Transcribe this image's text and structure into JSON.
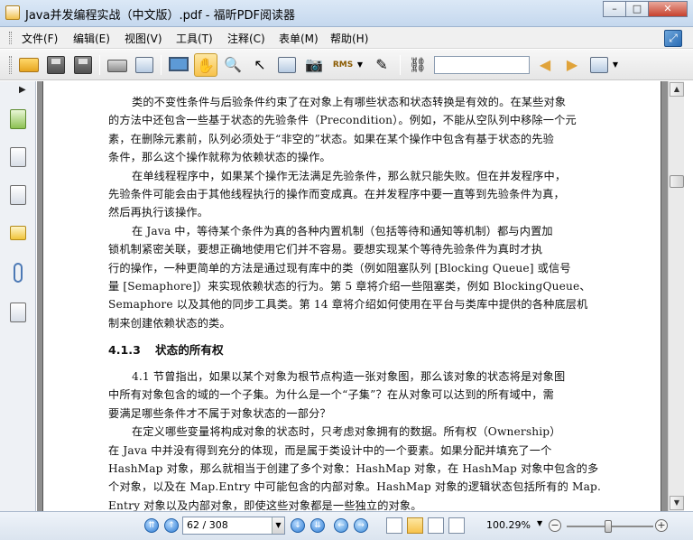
{
  "window": {
    "title": "Java并发编程实战（中文版）.pdf - 福昕PDF阅读器",
    "minimize": "–",
    "maximize": "□",
    "close": "✕"
  },
  "menu": [
    "文件(F)",
    "编辑(E)",
    "视图(V)",
    "工具(T)",
    "注释(C)",
    "表单(M)",
    "帮助(H)"
  ],
  "toolbar": {
    "icons": [
      "open-folder-icon",
      "save-icon",
      "save-as-icon",
      "print-icon",
      "email-icon",
      "fullscreen-icon",
      "hand-tool-icon",
      "zoom-tool-icon",
      "select-arrow-icon",
      "text-select-icon",
      "snapshot-icon",
      "rms-icon",
      "sign-icon",
      "find-binoculars-icon",
      "prev-result-icon",
      "next-result-icon",
      "highlight-icon"
    ],
    "rms_label": "RMS",
    "search_value": ""
  },
  "document": {
    "paragraph1": [
      "类的不变性条件与后验条件约束了在对象上有哪些状态和状态转换是有效的。在某些对象",
      "的方法中还包含一些基于状态的先验条件（Precondition）。例如，不能从空队列中移除一个元",
      "素，在删除元素前，队列必须处于“非空的”状态。如果在某个操作中包含有基于状态的先验",
      "条件，那么这个操作就称为依赖状态的操作。"
    ],
    "paragraph2": [
      "在单线程程序中，如果某个操作无法满足先验条件，那么就只能失败。但在并发程序中，",
      "先验条件可能会由于其他线程执行的操作而变成真。在并发程序中要一直等到先验条件为真，",
      "然后再执行该操作。"
    ],
    "paragraph3": [
      "在 Java 中，等待某个条件为真的各种内置机制（包括等待和通知等机制）都与内置加",
      "锁机制紧密关联，要想正确地使用它们并不容易。要想实现某个等待先验条件为真时才执",
      "行的操作，一种更简单的方法是通过现有库中的类（例如阻塞队列 [Blocking Queue] 或信号",
      "量 [Semaphore]）来实现依赖状态的行为。第 5 章将介绍一些阻塞类，例如 BlockingQueue、",
      "Semaphore 以及其他的同步工具类。第 14 章将介绍如何使用在平台与类库中提供的各种底层机",
      "制来创建依赖状态的类。"
    ],
    "section_number": "4.1.3",
    "section_title": "状态的所有权",
    "paragraph4": [
      "4.1 节曾指出，如果以某个对象为根节点构造一张对象图，那么该对象的状态将是对象图",
      "中所有对象包含的域的一个子集。为什么是一个“子集”？在从对象可以达到的所有域中，需",
      "要满足哪些条件才不属于对象状态的一部分？"
    ],
    "paragraph5": [
      "在定义哪些变量将构成对象的状态时，只考虑对象拥有的数据。所有权（Ownership）",
      "在 Java 中并没有得到充分的体现，而是属于类设计中的一个要素。如果分配并填充了一个",
      "HashMap 对象，那么就相当于创建了多个对象：HashMap 对象，在 HashMap 对象中包含的多",
      "个对象，以及在 Map.Entry 中可能包含的内部对象。HashMap 对象的逻辑状态包括所有的 Map.",
      "Entry 对象以及内部对象，即使这些对象都是一些独立的对象。"
    ]
  },
  "status": {
    "page_indicator": "62 / 308",
    "zoom_level": "100.29%",
    "zoom_minus": "−",
    "zoom_plus": "+"
  }
}
